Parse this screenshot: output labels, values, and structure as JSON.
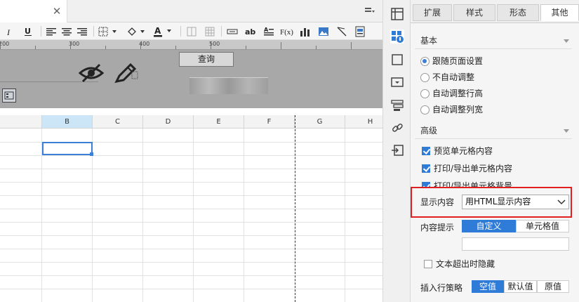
{
  "editor": {
    "ruler_labels": [
      "200",
      "300",
      "400",
      "500"
    ],
    "query_button": "查询",
    "columns": [
      "B",
      "C",
      "D",
      "E",
      "F",
      "G",
      "H"
    ]
  },
  "panel": {
    "tabs": [
      "扩展",
      "样式",
      "形态",
      "其他"
    ],
    "active_tab": "其他",
    "basic": {
      "title": "基本",
      "options": [
        "跟随页面设置",
        "不自动调整",
        "自动调整行高",
        "自动调整列宽"
      ],
      "selected": "跟随页面设置"
    },
    "advanced": {
      "title": "高级",
      "checks": [
        "预览单元格内容",
        "打印/导出单元格内容",
        "打印/导出单元格背景"
      ]
    },
    "display_content": {
      "label": "显示内容",
      "value": "用HTML显示内容"
    },
    "content_tip": {
      "label": "内容提示",
      "options": [
        "自定义",
        "单元格值"
      ],
      "active": "自定义",
      "input_value": ""
    },
    "hide_overflow": {
      "label": "文本超出时隐藏",
      "checked": false
    },
    "insert_policy": {
      "label": "插入行策略",
      "options": [
        "空值",
        "默认值",
        "原值"
      ],
      "active": "空值"
    }
  },
  "colors": {
    "accent": "#2f7bd8",
    "highlight_border": "#e02020"
  }
}
